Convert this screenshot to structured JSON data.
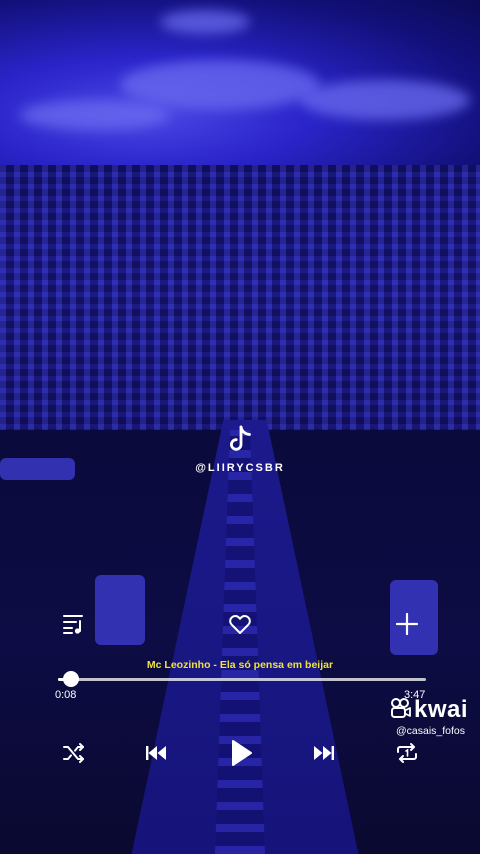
{
  "watermark": {
    "handle": "@LIIRYCSBR",
    "icon": "tiktok-icon"
  },
  "player": {
    "song_title": "Mc Leozinho - Ela só pensa em beijar",
    "elapsed": "0:08",
    "duration": "3:47",
    "progress_fraction": 0.035,
    "liked": false
  },
  "kwai": {
    "brand": "kwai",
    "user": "@casais_fofos",
    "icon": "kwai-icon"
  },
  "icons": {
    "queue": "playlist-icon",
    "like": "heart-icon",
    "add": "plus-icon",
    "shuffle": "shuffle-icon",
    "previous": "skip-previous-icon",
    "play": "play-icon",
    "next": "skip-next-icon",
    "repeat": "repeat-one-icon"
  },
  "colors": {
    "song_title": "#f0e23a",
    "tint": "#2a24c9"
  }
}
